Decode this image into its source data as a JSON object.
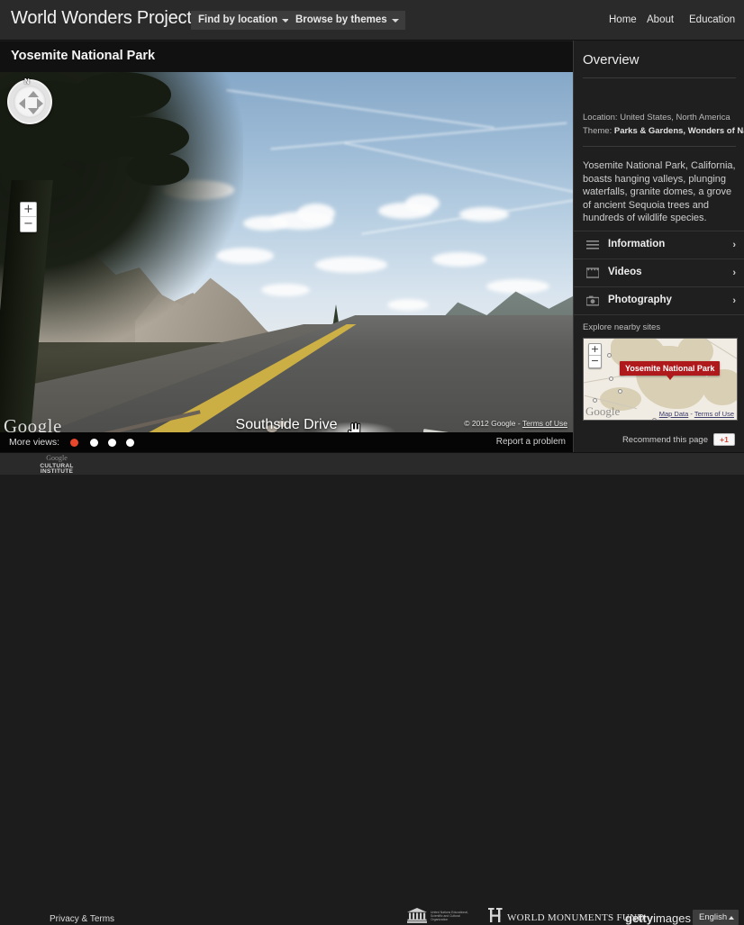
{
  "topnav": {
    "brand": "World Wonders Project",
    "buttons": [
      {
        "label": "Find by location",
        "icon": "chevron-down-icon"
      },
      {
        "label": "Browse by themes",
        "icon": "chevron-down-icon"
      }
    ],
    "links": [
      "Home",
      "About",
      "Education"
    ]
  },
  "place": {
    "title": "Yosemite National Park"
  },
  "streetview": {
    "street_name": "Southside Drive",
    "google_watermark": "Google",
    "copyright": "© 2012 Google - ",
    "terms_label": "Terms of Use",
    "compass_north": "N",
    "zoom_in": "+",
    "zoom_out": "−",
    "cursor": "hand-cursor"
  },
  "moreviews": {
    "label": "More views:",
    "dots": 4,
    "active_index": 0,
    "active_color": "#e8472b",
    "report_label": "Report a problem"
  },
  "sidebar": {
    "title": "Overview",
    "location_key": "Location: ",
    "location_value": "United States, North America",
    "theme_key": "Theme: ",
    "theme_value": "Parks & Gardens, Wonders of Nature",
    "description": "Yosemite National Park, California, boasts hanging valleys, plunging waterfalls, granite domes, a grove of ancient Sequoia trees and hundreds of wildlife species.",
    "accordion": [
      {
        "label": "Information",
        "icon": "list-lines-icon",
        "chevron": "›"
      },
      {
        "label": "Videos",
        "icon": "film-strip-icon",
        "chevron": "›"
      },
      {
        "label": "Photography",
        "icon": "camera-icon",
        "chevron": "›"
      }
    ],
    "nearby_label": "Explore nearby sites",
    "minimap": {
      "marker_label": "Yosemite National Park",
      "google_watermark": "Google",
      "map_data_label": "Map Data",
      "terms_label": "Terms of Use",
      "separator": " - ",
      "zoom_in": "+",
      "zoom_out": "−"
    },
    "recommend_label": "Recommend this page",
    "plusone_label": "+1"
  },
  "footer": {
    "gci_google": "Google",
    "gci_line1": "CULTURAL",
    "gci_line2": "INSTITUTE",
    "privacy": "Privacy & Terms",
    "unesco_text": "United Nations Educational, Scientific and Cultural Organization",
    "wmf": "WORLD MONUMENTS FUND",
    "getty_bold": "getty",
    "getty_light": "images",
    "language": "English"
  }
}
